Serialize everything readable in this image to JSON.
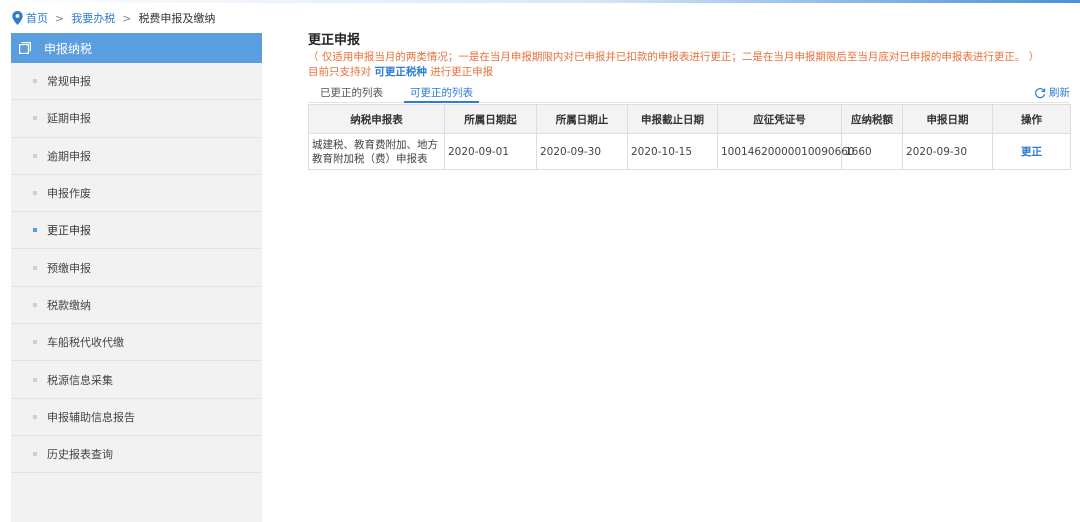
{
  "breadcrumb": {
    "home": "首页",
    "separator": ">",
    "section": "我要办税",
    "current": "税费申报及缴纳"
  },
  "sidebar": {
    "title": "申报纳税",
    "items": [
      {
        "label": "常规申报"
      },
      {
        "label": "延期申报"
      },
      {
        "label": "逾期申报"
      },
      {
        "label": "申报作废"
      },
      {
        "label": "更正申报"
      },
      {
        "label": "预缴申报"
      },
      {
        "label": "税款缴纳"
      },
      {
        "label": "车船税代收代缴"
      },
      {
        "label": "税源信息采集"
      },
      {
        "label": "申报辅助信息报告"
      },
      {
        "label": "历史报表查询"
      }
    ],
    "active_label": "更正申报"
  },
  "main": {
    "title": "更正申报",
    "notice": "（ 仅适用申报当月的两类情况；一是在当月申报期限内对已申报并已扣款的申报表进行更正；二是在当月申报期限后至当月底对已申报的申报表进行更正。 ）",
    "notice2_prefix": "目前只支持对",
    "notice2_link": "可更正税种",
    "notice2_suffix": "进行更正申报",
    "tabs": [
      {
        "label": "已更正的列表"
      },
      {
        "label": "可更正的列表"
      }
    ],
    "active_tab": "可更正的列表",
    "refresh_label": "刷新"
  },
  "table": {
    "columns": [
      "纳税申报表",
      "所属日期起",
      "所属日期止",
      "申报截止日期",
      "应征凭证号",
      "应纳税额",
      "申报日期",
      "操作"
    ],
    "rows": [
      {
        "form": "城建税、教育费附加、地方教育附加税（费）申报表",
        "period_start": "2020-09-01",
        "period_end": "2020-09-30",
        "deadline": "2020-10-15",
        "voucher": "10014620000010090660",
        "tax_amount": "1660",
        "declare_date": "2020-09-30",
        "action": "更正"
      }
    ]
  },
  "colors": {
    "accent": "#2f7cd3",
    "sidebar_header": "#5b9ee0",
    "notice": "#e8703a",
    "sidebar_bg": "#f2f2f2"
  },
  "icons": [
    "location-pin-icon",
    "menu-list-icon",
    "refresh-icon"
  ]
}
